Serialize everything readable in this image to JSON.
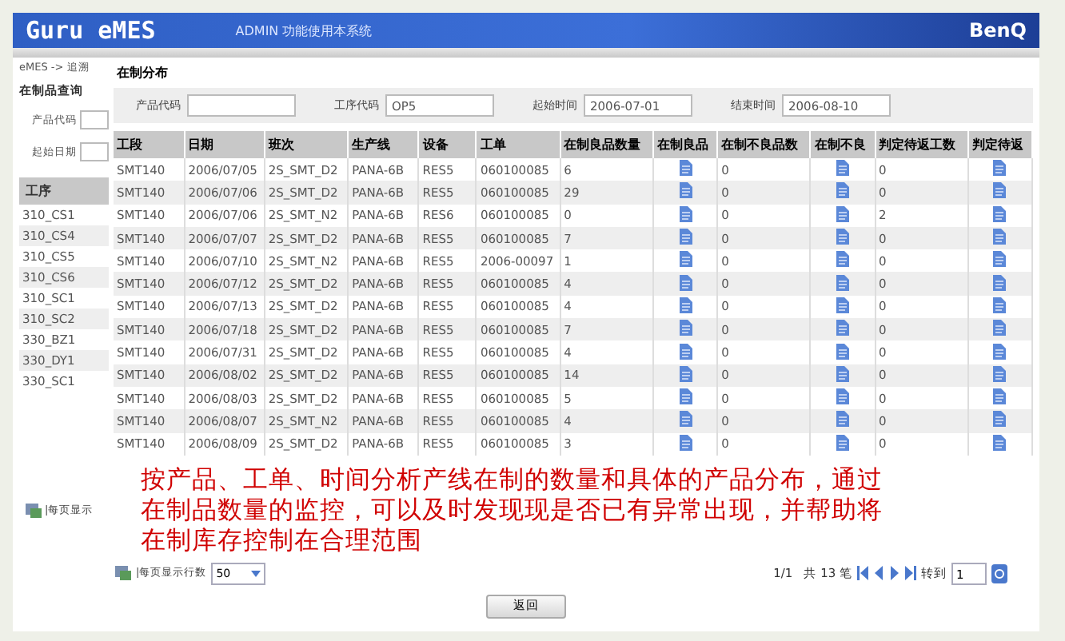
{
  "header": {
    "logo": "Guru eMES",
    "user": "ADMIN",
    "system": "功能使用本系统",
    "brand": "BenQ"
  },
  "sidebar": {
    "breadcrumb": "eMES -> 追溯",
    "title": "在制品查询",
    "fields": [
      {
        "label": "产品代码"
      },
      {
        "label": "起始日期"
      }
    ],
    "list_title": "工序",
    "items": [
      "310_CS1",
      "310_CS4",
      "310_CS5",
      "310_CS6",
      "310_SC1",
      "310_SC2",
      "330_BZ1",
      "330_DY1",
      "330_SC1"
    ],
    "per_page": "|每页显示"
  },
  "main": {
    "title": "在制分布",
    "filters": [
      {
        "label": "产品代码"
      },
      {
        "label": "工序代码",
        "value": "OP5"
      },
      {
        "label": "起始时间",
        "value": "2006-07-01"
      },
      {
        "label": "结束时间",
        "value": "2006-08-10"
      }
    ],
    "columns": [
      {
        "label": "工段",
        "kind": "text"
      },
      {
        "label": "日期",
        "kind": "text"
      },
      {
        "label": "班次",
        "kind": "text"
      },
      {
        "label": "生产线",
        "kind": "text"
      },
      {
        "label": "设备",
        "kind": "text"
      },
      {
        "label": "工单",
        "kind": "text"
      },
      {
        "label": "在制良品数量",
        "kind": "text"
      },
      {
        "label": "在制良品",
        "kind": "icon"
      },
      {
        "label": "在制不良品数",
        "kind": "text"
      },
      {
        "label": "在制不良",
        "kind": "icon"
      },
      {
        "label": "判定待返工数",
        "kind": "text"
      },
      {
        "label": "判定待返",
        "kind": "icon"
      }
    ],
    "rows": [
      [
        "SMT140",
        "2006/07/05",
        "2S_SMT_D2",
        "PANA-6B",
        "RES5",
        "060100085",
        "6",
        "",
        "0",
        "",
        "0",
        ""
      ],
      [
        "SMT140",
        "2006/07/06",
        "2S_SMT_D2",
        "PANA-6B",
        "RES5",
        "060100085",
        "29",
        "",
        "0",
        "",
        "0",
        ""
      ],
      [
        "SMT140",
        "2006/07/06",
        "2S_SMT_N2",
        "PANA-6B",
        "RES6",
        "060100085",
        "0",
        "",
        "0",
        "",
        "2",
        ""
      ],
      [
        "SMT140",
        "2006/07/07",
        "2S_SMT_D2",
        "PANA-6B",
        "RES5",
        "060100085",
        "7",
        "",
        "0",
        "",
        "0",
        ""
      ],
      [
        "SMT140",
        "2006/07/10",
        "2S_SMT_N2",
        "PANA-6B",
        "RES5",
        "2006-00097",
        "1",
        "",
        "0",
        "",
        "0",
        ""
      ],
      [
        "SMT140",
        "2006/07/12",
        "2S_SMT_D2",
        "PANA-6B",
        "RES5",
        "060100085",
        "4",
        "",
        "0",
        "",
        "0",
        ""
      ],
      [
        "SMT140",
        "2006/07/13",
        "2S_SMT_D2",
        "PANA-6B",
        "RES5",
        "060100085",
        "4",
        "",
        "0",
        "",
        "0",
        ""
      ],
      [
        "SMT140",
        "2006/07/18",
        "2S_SMT_D2",
        "PANA-6B",
        "RES5",
        "060100085",
        "7",
        "",
        "0",
        "",
        "0",
        ""
      ],
      [
        "SMT140",
        "2006/07/31",
        "2S_SMT_D2",
        "PANA-6B",
        "RES5",
        "060100085",
        "4",
        "",
        "0",
        "",
        "0",
        ""
      ],
      [
        "SMT140",
        "2006/08/02",
        "2S_SMT_D2",
        "PANA-6B",
        "RES5",
        "060100085",
        "14",
        "",
        "0",
        "",
        "0",
        ""
      ],
      [
        "SMT140",
        "2006/08/03",
        "2S_SMT_D2",
        "PANA-6B",
        "RES5",
        "060100085",
        "5",
        "",
        "0",
        "",
        "0",
        ""
      ],
      [
        "SMT140",
        "2006/08/07",
        "2S_SMT_N2",
        "PANA-6B",
        "RES5",
        "060100085",
        "4",
        "",
        "0",
        "",
        "0",
        ""
      ],
      [
        "SMT140",
        "2006/08/09",
        "2S_SMT_D2",
        "PANA-6B",
        "RES5",
        "060100085",
        "3",
        "",
        "0",
        "",
        "0",
        ""
      ]
    ],
    "annotation": "按产品、工单、时间分析产线在制的数量和具体的产品分布，通过在制品数量的监控，可以及时发现现是否已有异常出现，并帮助将在制库存控制在合理范围",
    "pager": {
      "per_page_label": "|每页显示行数",
      "per_page": "50",
      "page": "1/1",
      "total": "共 13 笔",
      "goto_label": "转到",
      "goto_value": "1"
    },
    "back_button": "返回"
  }
}
